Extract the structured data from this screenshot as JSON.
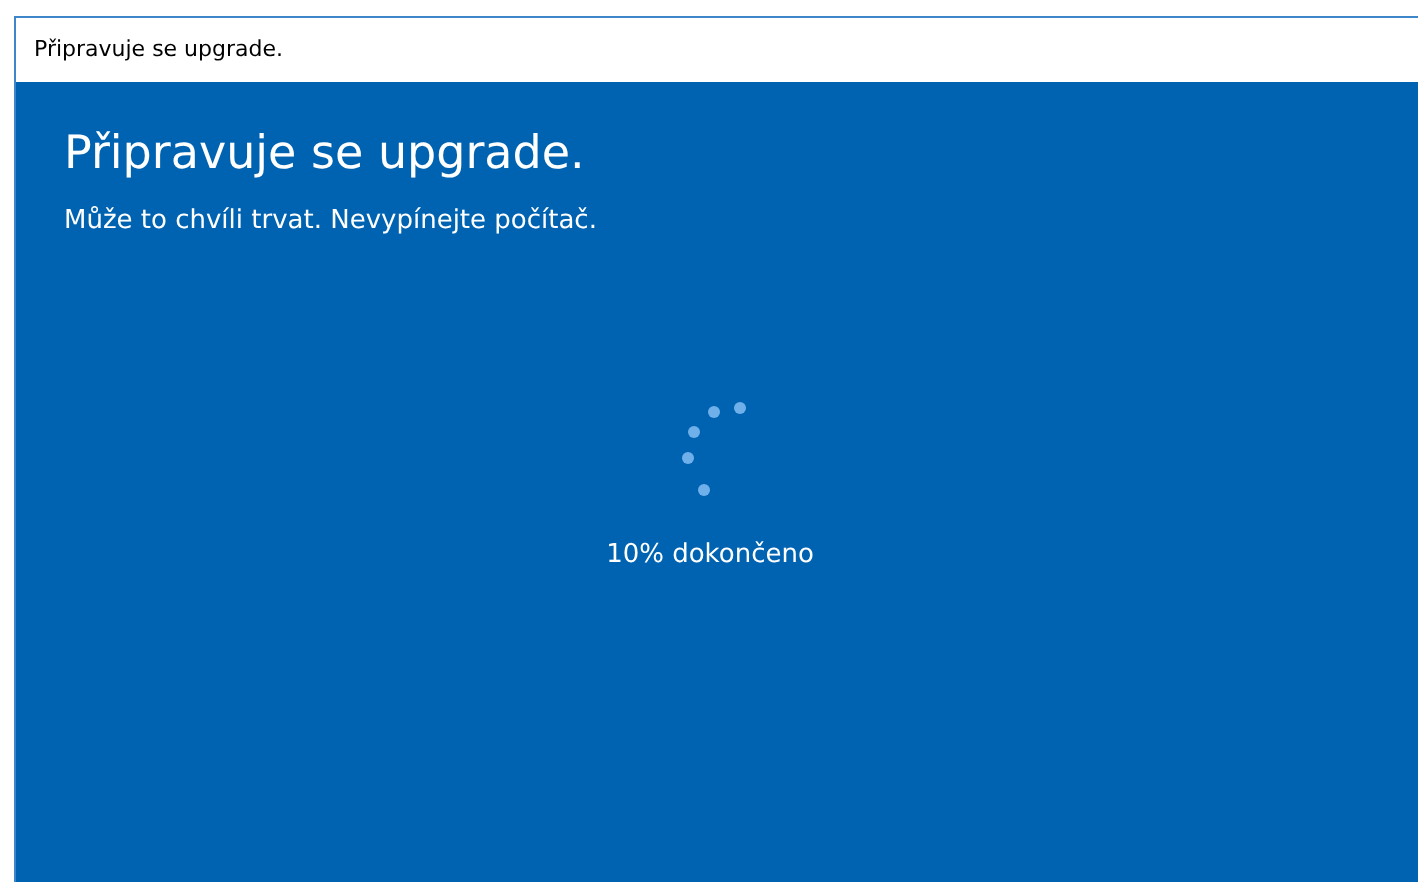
{
  "window": {
    "title": "Připravuje se upgrade."
  },
  "heading": "Připravuje se upgrade.",
  "subtitle": "Může to chvíli trvat. Nevypínejte počítač.",
  "progress": {
    "text": "10% dokončeno"
  }
}
